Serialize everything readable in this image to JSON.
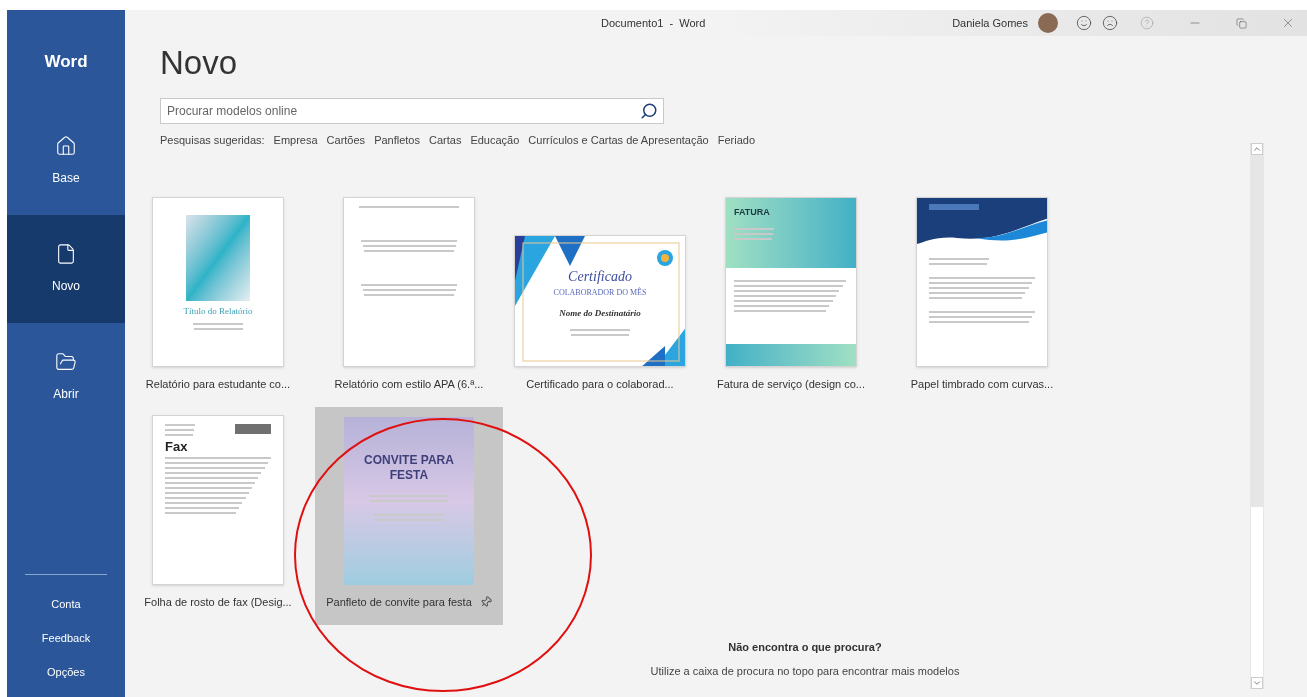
{
  "window": {
    "title": "Documento1  -  Word",
    "user": "Daniela Gomes"
  },
  "sidebar": {
    "app_name": "Word",
    "items": [
      {
        "label": "Base",
        "selected": false
      },
      {
        "label": "Novo",
        "selected": true
      },
      {
        "label": "Abrir",
        "selected": false
      }
    ],
    "footer_items": [
      "Conta",
      "Feedback",
      "Opções"
    ]
  },
  "page": {
    "heading": "Novo",
    "search": {
      "placeholder": "Procurar modelos online"
    },
    "suggested": {
      "label": "Pesquisas sugeridas:",
      "items": [
        "Empresa",
        "Cartões",
        "Panfletos",
        "Cartas",
        "Educação",
        "Currículos e Cartas de Apresentação",
        "Feriado"
      ]
    }
  },
  "templates": [
    {
      "kind": "photo-report",
      "label": "Relatório para estudante co...",
      "preview_texts": [
        "Título do Relatório"
      ],
      "selected": false
    },
    {
      "kind": "text-report",
      "label": "Relatório com estilo APA (6.ª...",
      "selected": false
    },
    {
      "kind": "certificate",
      "label": "Certificado para o colaborad...",
      "preview_texts": [
        "Certificado",
        "COLABORADOR DO MÊS",
        "Nome do Destinatário"
      ],
      "selected": false
    },
    {
      "kind": "invoice",
      "label": "Fatura de serviço (design co...",
      "preview_texts": [
        "FATURA"
      ],
      "selected": false
    },
    {
      "kind": "letterhead",
      "label": "Papel timbrado com curvas...",
      "selected": false
    },
    {
      "kind": "fax",
      "label": "Folha de rosto de fax (Desig...",
      "preview_texts": [
        "Fax"
      ],
      "selected": false
    },
    {
      "kind": "flyer",
      "label": "Panfleto de convite para festa",
      "preview_texts": [
        "CONVITE PARA FESTA"
      ],
      "selected": true
    }
  ],
  "footer": {
    "title": "Não encontra o que procura?",
    "hint": "Utilize a caixa de procura no topo para encontrar mais modelos"
  }
}
